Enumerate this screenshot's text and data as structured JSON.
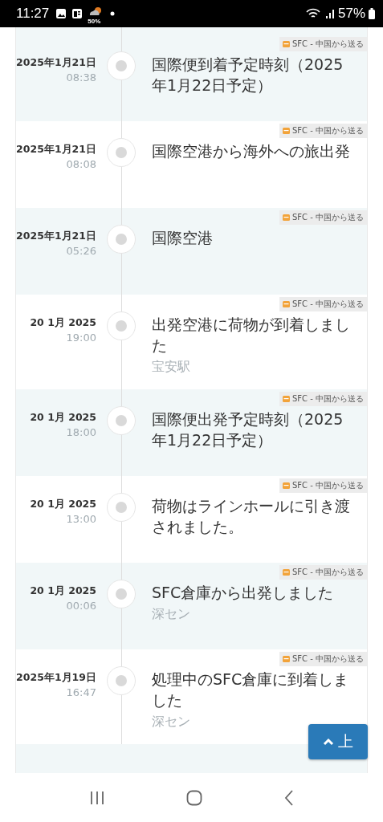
{
  "status_bar": {
    "time": "11:27",
    "weather_badge": "50%",
    "battery": "57%"
  },
  "events": [
    {
      "date": "2025年1月21日",
      "time": "08:38",
      "title": "国際便到着予定時刻（2025年1月22日予定）",
      "tag": "SFC - 中国から送る",
      "shaded": true
    },
    {
      "date": "2025年1月21日",
      "time": "08:08",
      "title": "国際空港から海外への旅出発",
      "tag": "SFC - 中国から送る",
      "shaded": false
    },
    {
      "date": "2025年1月21日",
      "time": "05:26",
      "title": "国際空港",
      "tag": "SFC - 中国から送る",
      "shaded": true
    },
    {
      "date": "20 1月 2025",
      "time": "19:00",
      "title": "出発空港に荷物が到着しました",
      "location": "宝安駅",
      "tag": "SFC - 中国から送る",
      "shaded": false
    },
    {
      "date": "20 1月 2025",
      "time": "18:00",
      "title": "国際便出発予定時刻（2025年1月22日予定）",
      "tag": "SFC - 中国から送る",
      "shaded": true
    },
    {
      "date": "20 1月 2025",
      "time": "13:00",
      "title": "荷物はラインホールに引き渡されました。",
      "tag": "SFC - 中国から送る",
      "shaded": false
    },
    {
      "date": "20 1月 2025",
      "time": "00:06",
      "title": "SFC倉庫から出発しました",
      "location": "深セン",
      "tag": "SFC - 中国から送る",
      "shaded": true
    },
    {
      "date": "2025年1月19日",
      "time": "16:47",
      "title": "処理中のSFC倉庫に到着しました",
      "location": "深セン",
      "tag": "SFC - 中国から送る",
      "shaded": false
    }
  ],
  "scroll_top_button": {
    "label": "上"
  }
}
